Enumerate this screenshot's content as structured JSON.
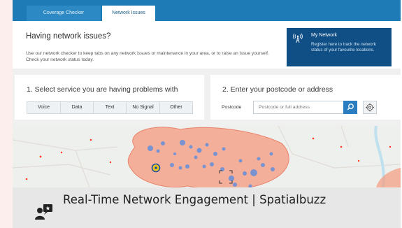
{
  "tabs": [
    {
      "label": "Coverage Checker"
    },
    {
      "label": "Network Issues"
    }
  ],
  "intro": {
    "heading": "Having network issues?",
    "text": "Use our network checker to keep tabs on any  network issues or maintenance in your area, or to raise an issue yourself. Check your  network status today."
  },
  "my_network": {
    "icon": "signal-tower-icon",
    "title": "My Network",
    "description": "Register here to track the network status of your favourite locations."
  },
  "step1": {
    "heading": "1. Select service you are having problems with",
    "services": [
      "Voice",
      "Data",
      "Text",
      "No Signal",
      "Other"
    ]
  },
  "step2": {
    "heading": "2. Enter your postcode or address",
    "postcode_label": "Postcode",
    "input_placeholder": "Postcode or full address",
    "input_value": "",
    "search_icon": "search-icon",
    "locate_icon": "crosshair-icon"
  },
  "map": {
    "area_color": "#f59a7d",
    "marker_color": "#6b8fd6"
  },
  "caption": {
    "icon": "chat-user-icon",
    "text": "Real-Time Network Engagement | Spatialbuzz"
  },
  "colors": {
    "header_blue": "#1f7bb6",
    "panel_navy": "#0f4f86",
    "search_button": "#2a7dc0",
    "left_strip": "#fbeeed"
  }
}
